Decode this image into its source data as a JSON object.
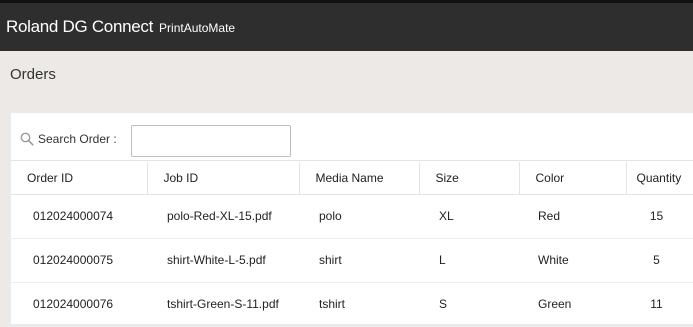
{
  "header": {
    "brand": "Roland DG Connect",
    "product": "PrintAutoMate"
  },
  "page": {
    "title": "Orders"
  },
  "search": {
    "label": "Search Order :",
    "value": "",
    "placeholder": ""
  },
  "table": {
    "columns": [
      "Order ID",
      "Job ID",
      "Media Name",
      "Size",
      "Color",
      "Quantity"
    ],
    "rows": [
      {
        "order_id": "012024000074",
        "job_id": "polo-Red-XL-15.pdf",
        "media_name": "polo",
        "size": "XL",
        "color": "Red",
        "quantity": "15"
      },
      {
        "order_id": "012024000075",
        "job_id": "shirt-White-L-5.pdf",
        "media_name": "shirt",
        "size": "L",
        "color": "White",
        "quantity": "5"
      },
      {
        "order_id": "012024000076",
        "job_id": "tshirt-Green-S-11.pdf",
        "media_name": "tshirt",
        "size": "S",
        "color": "Green",
        "quantity": "11"
      }
    ]
  },
  "icons": {
    "search": "search-icon"
  },
  "colors": {
    "topbar": "#2e2e2e",
    "page_background": "#ece9e7",
    "panel": "#ffffff"
  }
}
